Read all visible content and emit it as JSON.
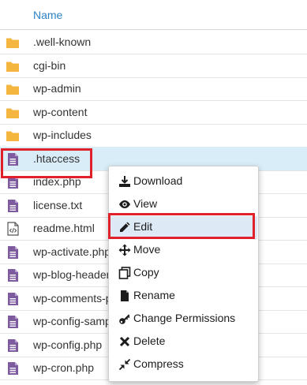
{
  "table": {
    "column_name": "Name"
  },
  "files": [
    {
      "name": ".well-known",
      "type": "folder"
    },
    {
      "name": "cgi-bin",
      "type": "folder"
    },
    {
      "name": "wp-admin",
      "type": "folder"
    },
    {
      "name": "wp-content",
      "type": "folder"
    },
    {
      "name": "wp-includes",
      "type": "folder"
    },
    {
      "name": ".htaccess",
      "type": "text",
      "selected": true
    },
    {
      "name": "index.php",
      "type": "text"
    },
    {
      "name": "license.txt",
      "type": "text"
    },
    {
      "name": "readme.html",
      "type": "code"
    },
    {
      "name": "wp-activate.php",
      "type": "text"
    },
    {
      "name": "wp-blog-header.php",
      "type": "text"
    },
    {
      "name": "wp-comments-post.php",
      "type": "text"
    },
    {
      "name": "wp-config-sample.php",
      "type": "text"
    },
    {
      "name": "wp-config.php",
      "type": "text"
    },
    {
      "name": "wp-cron.php",
      "type": "text"
    }
  ],
  "context_menu": {
    "items": [
      {
        "label": "Download",
        "icon": "download-icon"
      },
      {
        "label": "View",
        "icon": "eye-icon"
      },
      {
        "label": "Edit",
        "icon": "pencil-icon",
        "active": true
      },
      {
        "label": "Move",
        "icon": "move-arrows-icon"
      },
      {
        "label": "Copy",
        "icon": "copy-icon"
      },
      {
        "label": "Rename",
        "icon": "file-icon"
      },
      {
        "label": "Change Permissions",
        "icon": "key-icon"
      },
      {
        "label": "Delete",
        "icon": "close-icon"
      },
      {
        "label": "Compress",
        "icon": "compress-icon"
      }
    ]
  },
  "colors": {
    "header_text": "#2f83c4",
    "folder": "#f5b63f",
    "file_icon": "#7e5a9e",
    "selected_row": "#d9edf8",
    "highlight_border": "#e0202a"
  }
}
